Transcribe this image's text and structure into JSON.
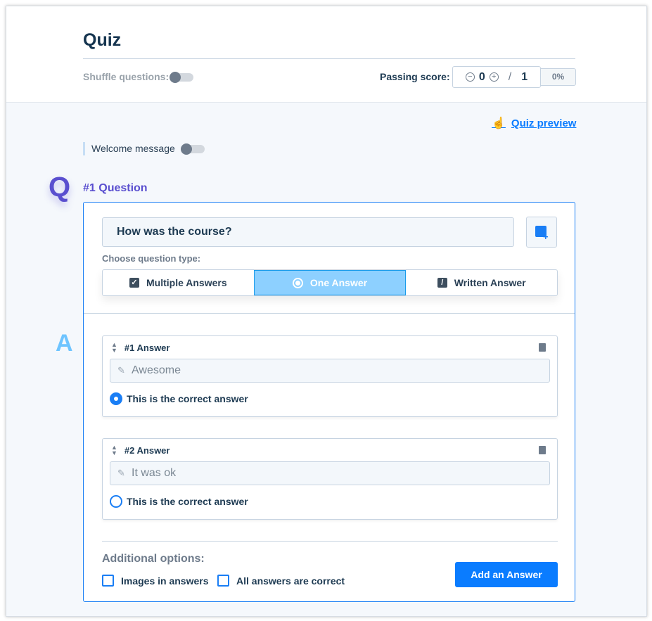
{
  "header": {
    "title": "Quiz",
    "shuffle_label": "Shuffle questions:",
    "passing_label": "Passing score:",
    "score": "0",
    "slash": "/",
    "total": "1",
    "percent": "0%"
  },
  "preview_link": "Quiz preview",
  "welcome_label": "Welcome message",
  "question": {
    "badge": "Q",
    "heading": "#1 Question",
    "text": "How was the course?",
    "type_label": "Choose question type:",
    "types": [
      {
        "label": "Multiple Answers"
      },
      {
        "label": "One Answer",
        "selected": true
      },
      {
        "label": "Written Answer"
      }
    ]
  },
  "answers_badge": "A",
  "answers": [
    {
      "heading": "#1 Answer",
      "value": "Awesome",
      "correct_label": "This is the correct answer",
      "correct": true
    },
    {
      "heading": "#2 Answer",
      "value": "It was ok",
      "correct_label": "This is the correct answer",
      "correct": false
    }
  ],
  "options": {
    "heading": "Additional options:",
    "images": "Images in answers",
    "all_correct": "All answers are correct",
    "add_button": "Add an Answer"
  },
  "colors": {
    "accent": "#0a7cff",
    "selected_type": "#8dd0ff",
    "question_heading": "#5a4fcf"
  }
}
